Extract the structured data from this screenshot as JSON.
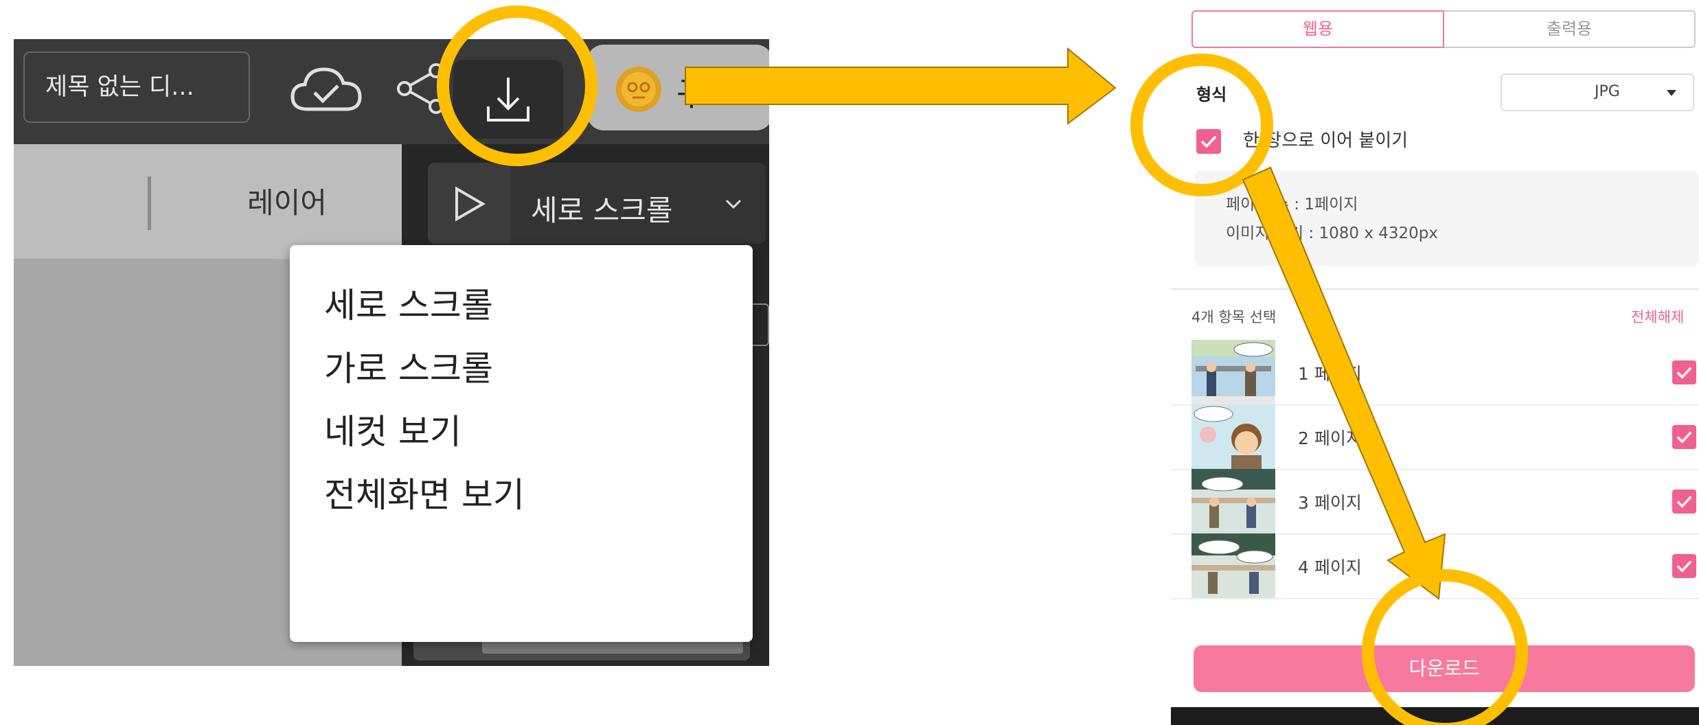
{
  "editor": {
    "doc_title": "제목 없는 디...",
    "coin_label": "구",
    "layer_label": "레이어",
    "view_mode_selected": "세로 스크롤",
    "view_menu": {
      "items": [
        "세로 스크롤",
        "가로 스크롤",
        "네컷 보기",
        "전체화면 보기"
      ]
    }
  },
  "download_panel": {
    "tabs": [
      "웹용",
      "출력용"
    ],
    "format_label": "형식",
    "format_value": "JPG",
    "merge_label": "한 장으로 이어 붙이기",
    "info": {
      "pages": "페이지 수 : 1페이지",
      "size": "이미지 크기 : 1080 x 4320px"
    },
    "select_count": "4개 항목 선택",
    "deselect_all": "전체해제",
    "pages": [
      "1 페이지",
      "2 페이지",
      "3 페이지",
      "4 페이지"
    ],
    "download_button": "다운로드"
  },
  "colors": {
    "accent_pink": "#f7799e",
    "annotation_yellow": "#ffbf00",
    "editor_dark": "#3a3a3a"
  },
  "icons": [
    "cloud-check-icon",
    "share-icon",
    "download-icon",
    "coin-icon",
    "play-icon",
    "chevron-down-icon",
    "checkbox-checked-icon"
  ]
}
